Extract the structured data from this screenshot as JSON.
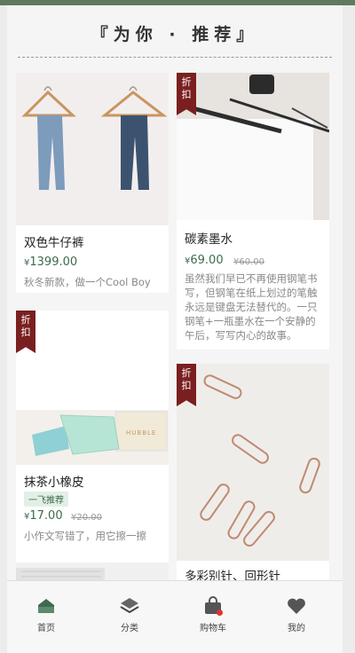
{
  "section": {
    "title": "『为你 · 推荐』"
  },
  "products": [
    {
      "name": "双色牛仔裤",
      "price": "1399.00",
      "currency": "¥",
      "desc": "秋冬新款，做一个Cool Boy"
    },
    {
      "ribbon": [
        "折",
        "扣"
      ],
      "name": "碳素墨水",
      "price": "69.00",
      "currency": "¥",
      "old_price": "¥60.00",
      "desc": "虽然我们早已不再使用钢笔书写，但钢笔在纸上划过的笔触永远是键盘无法替代的。一只钢笔+一瓶墨水在一个安静的午后，写写内心的故事。"
    },
    {
      "ribbon": [
        "折",
        "扣"
      ],
      "name": "抹茶小橡皮",
      "tag": "一飞推荐",
      "price": "17.00",
      "currency": "¥",
      "old_price": "¥20.00",
      "desc": "小作文写错了，用它擦一擦"
    },
    {
      "ribbon": [
        "折",
        "扣"
      ],
      "name": "多彩别针、回形针"
    }
  ],
  "eraser_print": "HUBBLE",
  "tabbar": [
    {
      "label": "首页",
      "icon": "home-icon"
    },
    {
      "label": "分类",
      "icon": "category-icon"
    },
    {
      "label": "购物车",
      "icon": "cart-icon"
    },
    {
      "label": "我的",
      "icon": "heart-icon"
    }
  ],
  "colors": {
    "accent": "#3d6b4a",
    "ribbon": "#7a1f1f",
    "topbar": "#5f7a5f"
  }
}
